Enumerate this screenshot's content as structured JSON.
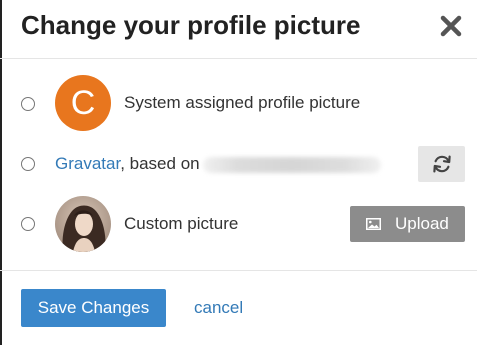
{
  "dialog": {
    "title": "Change your profile picture",
    "close_icon": "close-icon"
  },
  "options": {
    "system": {
      "avatar_letter": "C",
      "avatar_color": "#e8761e",
      "label": "System assigned profile picture",
      "selected": false
    },
    "gravatar": {
      "link_text": "Gravatar",
      "label_suffix": ", based on",
      "email_redacted": true,
      "refresh_icon": "refresh-icon",
      "selected": false
    },
    "custom": {
      "label": "Custom picture",
      "upload_label": "Upload",
      "upload_icon": "image-icon",
      "selected": false
    }
  },
  "footer": {
    "save_label": "Save Changes",
    "cancel_label": "cancel"
  },
  "colors": {
    "primary": "#3a87cb",
    "link": "#337ab7",
    "upload_button": "#8c8c8c",
    "refresh_button": "#e6e6e6"
  }
}
